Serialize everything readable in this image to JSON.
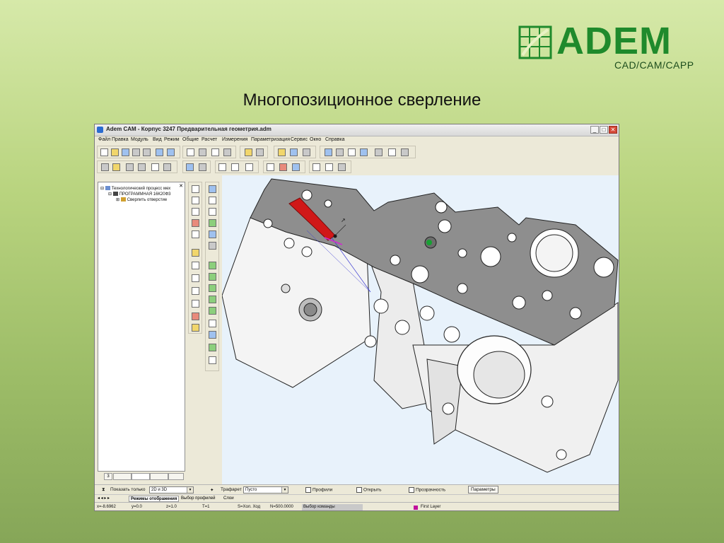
{
  "logo": {
    "text": "ADEM",
    "subtitle": "CAD/CAM/CAPP",
    "color": "#1f8a2c"
  },
  "slide": {
    "title": "Многопозиционное сверление"
  },
  "window": {
    "title": "Adem CAM - Корпус 3247 Предварительная геометрия.adm",
    "controls": {
      "minimize": "_",
      "maximize": "□",
      "close": "✕"
    }
  },
  "menu": [
    "Файл",
    "Правка",
    "Модуль",
    "Вид",
    "Режим",
    "Общие",
    "Расчет",
    "Измерения",
    "Параметризация",
    "Сервис",
    "Окно",
    "Справка"
  ],
  "tree": {
    "items": [
      {
        "label": "Технологический процесс мех"
      },
      {
        "label": "ПРОГРАММНАЯ 16К20Ф3"
      },
      {
        "label": "Сверлить отверстие"
      }
    ],
    "tabs": [
      "3",
      "",
      "",
      ""
    ]
  },
  "status1": {
    "show_only_label": "Показать только",
    "show_only_value": "2D и 3D",
    "stencil_label": "Трафарет",
    "stencil_value": "Пусто",
    "profiles_label": "Профили",
    "open_label": "Открыть",
    "transparency_label": "Прозрачность",
    "params_button": "Параметры"
  },
  "status2": {
    "tabs": [
      "Режимы отображения",
      "Выбор профилей",
      "Слои"
    ]
  },
  "status3": {
    "x": "x=-8.6962",
    "y": "y=0.0",
    "z": "z=1.0",
    "t": "T=1",
    "s": "S=Хол. Ход",
    "n": "N=500.0000",
    "command": "Выбор команды",
    "layer": "First Layer",
    "layer_color": "#c0109c"
  }
}
